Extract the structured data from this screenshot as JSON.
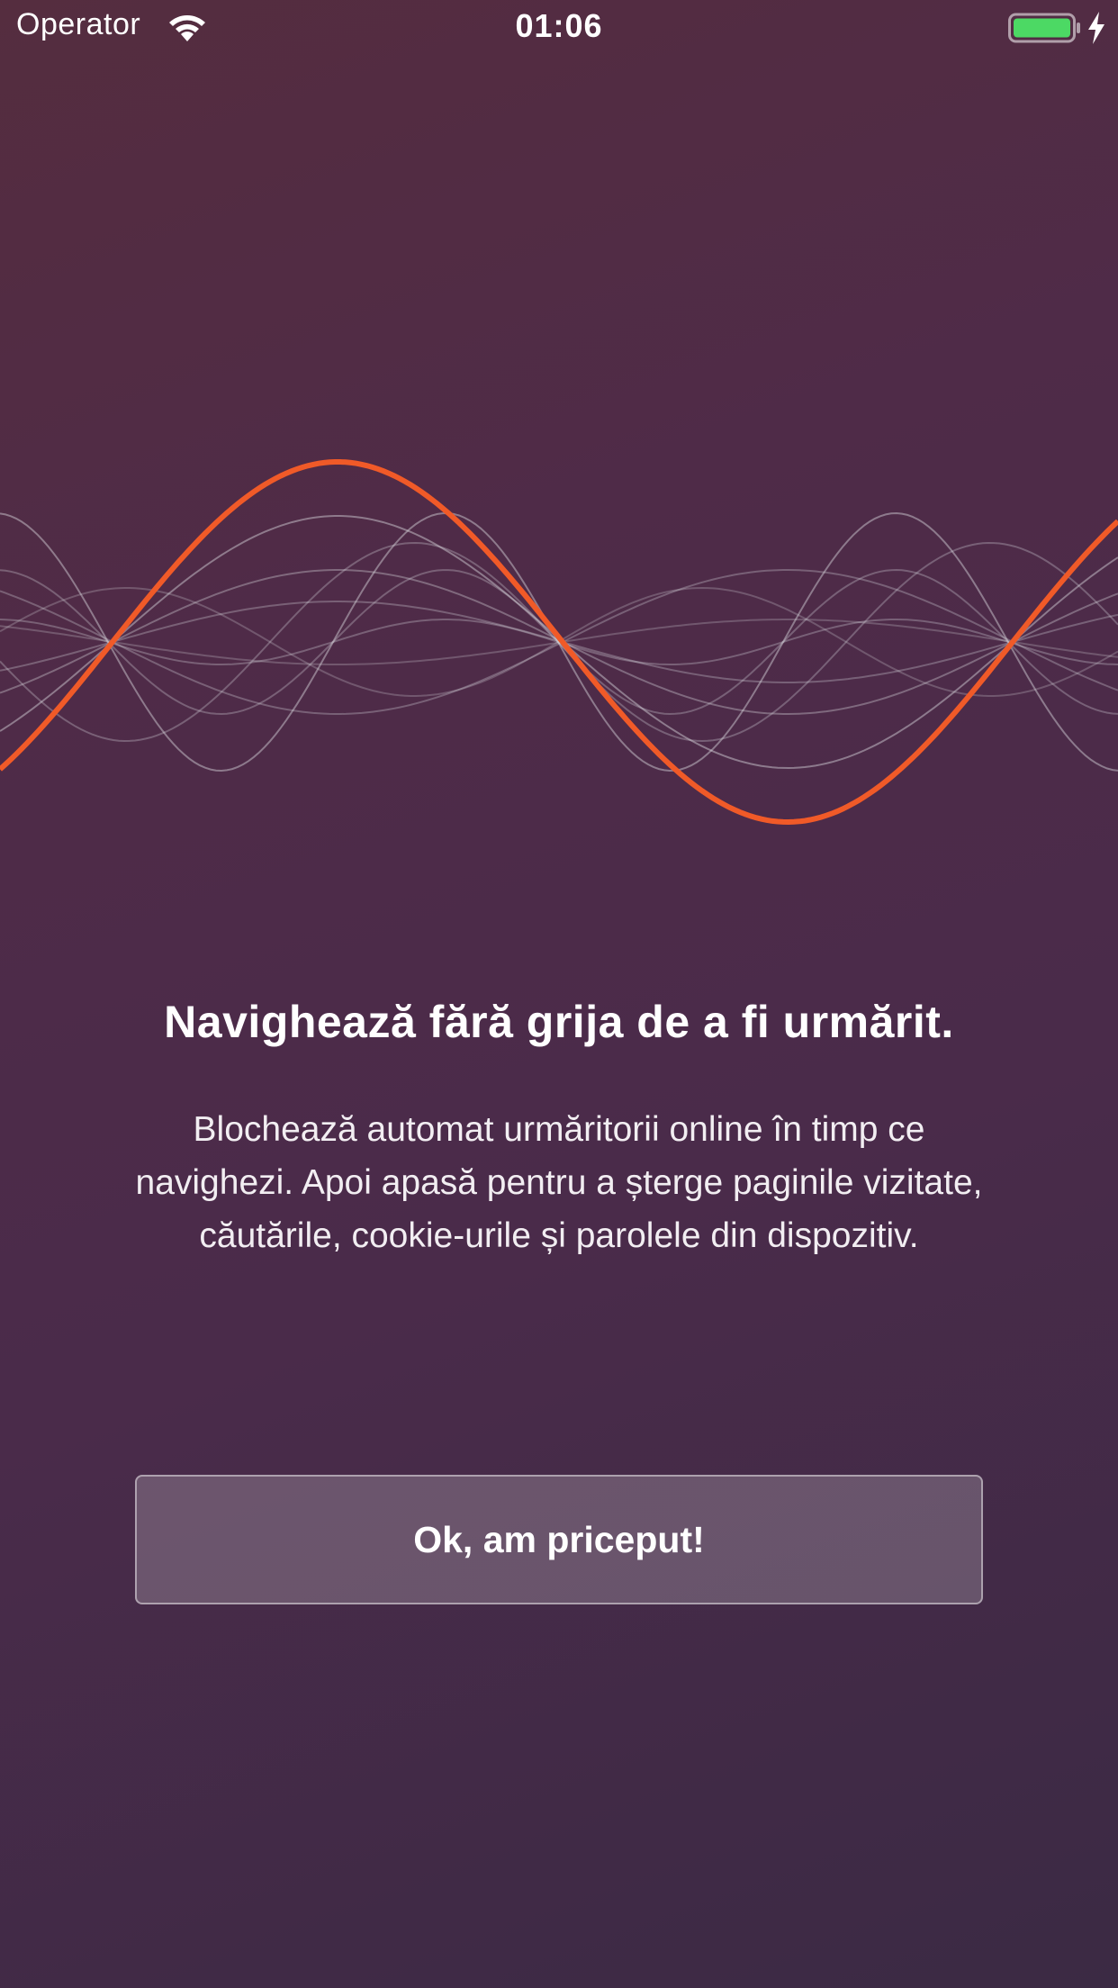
{
  "status_bar": {
    "carrier": "Operator",
    "time": "01:06",
    "icons": [
      "wifi-icon",
      "battery-icon",
      "charging-bolt-icon"
    ],
    "battery_color": "#4cd964"
  },
  "illustration": {
    "icon": "sound-wave-graphic",
    "accent_color": "#f05a28"
  },
  "onboarding": {
    "title": "Navighează fără grija de a fi urmărit.",
    "description": "Blochează automat urmăritorii online în timp ce navighezi. Apoi apasă pentru a șterge paginile vizitate, căutările, cookie-urile și parolele din dispozitiv.",
    "button_label": "Ok, am priceput!"
  }
}
